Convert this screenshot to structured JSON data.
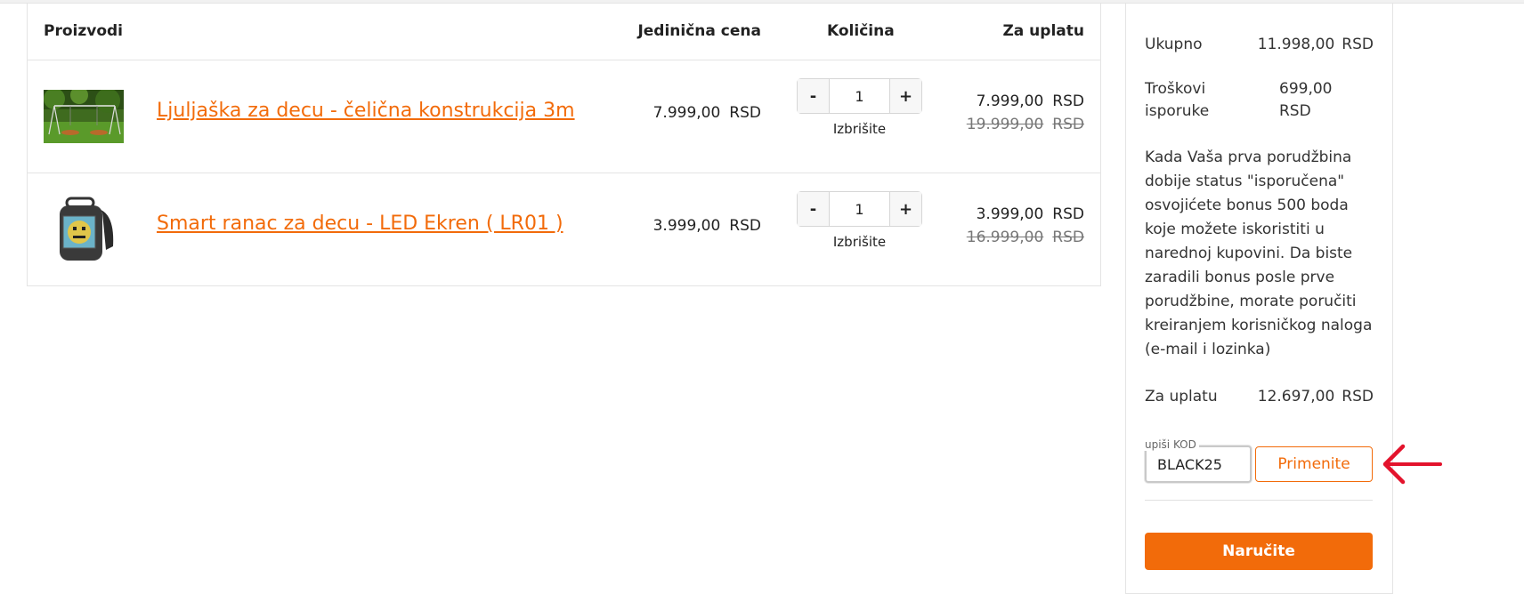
{
  "cart": {
    "headers": {
      "products": "Proizvodi",
      "unit_price": "Jedinična cena",
      "quantity": "Količina",
      "to_pay": "Za uplatu"
    },
    "items": [
      {
        "name": "Ljuljaška za decu - čelična konstrukcija 3m",
        "unit_price": "7.999,00",
        "currency": "RSD",
        "quantity": "1",
        "minus": "-",
        "plus": "+",
        "delete_label": "Izbrišite",
        "price": "7.999,00",
        "old_price": "19.999,00"
      },
      {
        "name": "Smart ranac za decu - LED Ekren ( LR01 )",
        "unit_price": "3.999,00",
        "currency": "RSD",
        "quantity": "1",
        "minus": "-",
        "plus": "+",
        "delete_label": "Izbrišite",
        "price": "3.999,00",
        "old_price": "16.999,00"
      }
    ]
  },
  "summary": {
    "total_label": "Ukupno",
    "total_value": "11.998,00",
    "shipping_label_1": "Troškovi",
    "shipping_label_2": "isporuke",
    "shipping_value": "699,00",
    "currency": "RSD",
    "bonus_text": "Kada Vaša prva porudžbina dobije status \"isporučena\" osvojićete bonus 500 boda koje možete iskoristiti u narednoj kupovini. Da biste zaradili bonus posle prve porudžbine, morate poručiti kreiranjem korisničkog naloga (e-mail i lozinka)",
    "pay_label": "Za uplatu",
    "pay_value": "12.697,00",
    "code_label": "upiši KOD",
    "code_value": "BLACK25",
    "apply_label": "Primenite",
    "order_label": "Naručite"
  },
  "colors": {
    "accent": "#f26b0a",
    "annotation_arrow": "#e3132c"
  },
  "icons": {
    "annotation": "left-arrow-icon"
  }
}
